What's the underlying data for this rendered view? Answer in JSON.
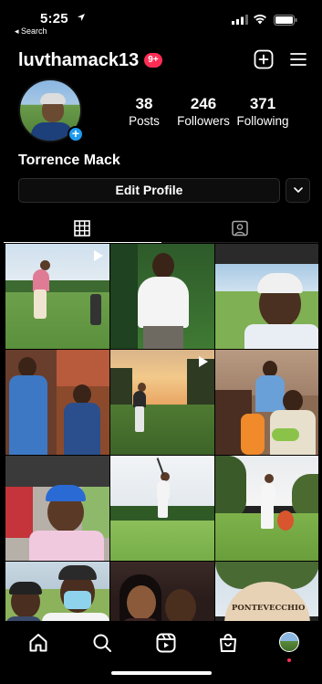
{
  "status_bar": {
    "time": "5:25",
    "back_label": "◂ Search"
  },
  "header": {
    "username": "luvthamack13",
    "notification_badge": "9+"
  },
  "profile": {
    "posts_count": "38",
    "posts_label": "Posts",
    "followers_count": "246",
    "followers_label": "Followers",
    "following_count": "371",
    "following_label": "Following",
    "display_name": "Torrence Mack",
    "edit_profile_label": "Edit Profile"
  },
  "tabs": [
    {
      "name": "grid",
      "icon": "grid-icon",
      "active": true
    },
    {
      "name": "tagged",
      "icon": "tagged-person-icon",
      "active": false
    }
  ],
  "posts": [
    {
      "scene": "golf-swing-range",
      "video": true
    },
    {
      "scene": "young-man-white-polo",
      "video": false
    },
    {
      "scene": "selfie-golf-cart-cap",
      "video": false
    },
    {
      "scene": "group-indoor-photo",
      "video": false
    },
    {
      "scene": "golfer-sunset",
      "video": true
    },
    {
      "scene": "family-couch",
      "video": false
    },
    {
      "scene": "selfie-blue-cap-car",
      "video": false
    },
    {
      "scene": "golfer-follow-through",
      "video": false
    },
    {
      "scene": "golfer-swing-trees",
      "video": false
    },
    {
      "scene": "selfie-mask",
      "video": false
    },
    {
      "scene": "couple-selfie",
      "video": false
    },
    {
      "scene": "ponte-vedra-sign",
      "video": false,
      "text": "PONTEVECCHIO"
    }
  ],
  "bottom_nav": [
    {
      "name": "home",
      "icon": "home-icon"
    },
    {
      "name": "search",
      "icon": "search-icon"
    },
    {
      "name": "reels",
      "icon": "reels-icon"
    },
    {
      "name": "shop",
      "icon": "shop-bag-icon"
    },
    {
      "name": "profile",
      "icon": "profile-avatar-icon"
    }
  ],
  "colors": {
    "background": "#000000",
    "badge": "#ff2d55",
    "avatar_plus": "#1d9bf0",
    "button_border": "#2c2c2c"
  }
}
